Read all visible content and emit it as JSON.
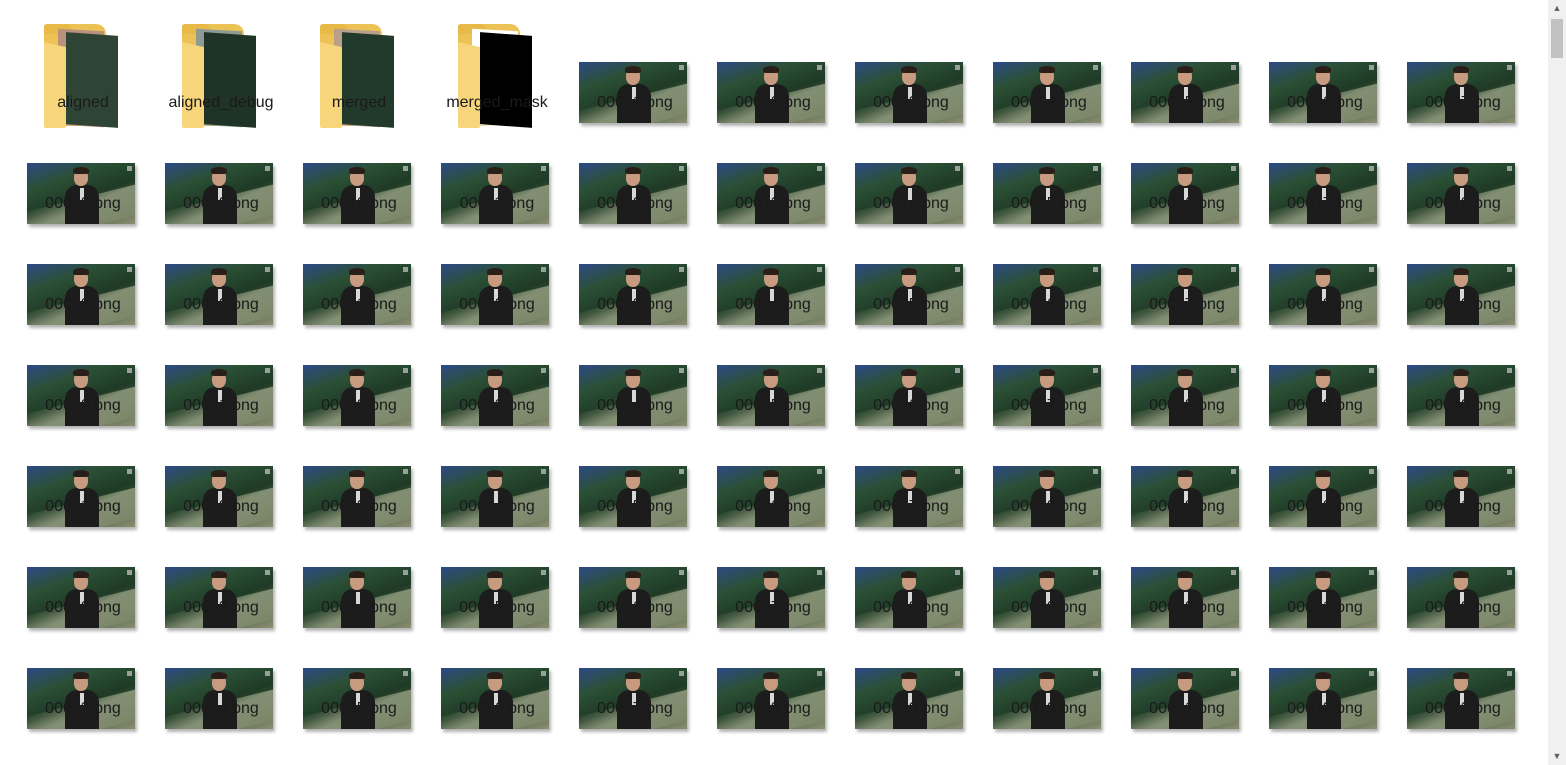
{
  "folders": [
    {
      "name": "aligned",
      "preview": "face"
    },
    {
      "name": "aligned_debug",
      "preview": "debug"
    },
    {
      "name": "merged",
      "preview": "merged"
    },
    {
      "name": "merged_mask",
      "preview": "dark"
    }
  ],
  "files": [
    "00001.png",
    "00002.png",
    "00003.png",
    "00004.png",
    "00005.png",
    "00006.png",
    "00007.png",
    "00008.png",
    "00009.png",
    "00010.png",
    "00011.png",
    "00012.png",
    "00013.png",
    "00014.png",
    "00015.png",
    "00016.png",
    "00017.png",
    "00018.png",
    "00019.png",
    "00020.png",
    "00021.png",
    "00022.png",
    "00023.png",
    "00024.png",
    "00025.png",
    "00026.png",
    "00027.png",
    "00028.png",
    "00029.png",
    "00030.png",
    "00031.png",
    "00032.png",
    "00033.png",
    "00034.png",
    "00035.png",
    "00036.png",
    "00037.png",
    "00038.png",
    "00039.png",
    "00040.png",
    "00041.png",
    "00042.png",
    "00043.png",
    "00044.png",
    "00045.png",
    "00046.png",
    "00047.png",
    "00048.png",
    "00049.png",
    "00050.png",
    "00051.png",
    "00052.png",
    "00053.png",
    "00054.png",
    "00055.png",
    "00056.png",
    "00057.png",
    "00058.png",
    "00059.png",
    "00060.png",
    "00061.png",
    "00062.png",
    "00063.png",
    "00064.png",
    "00065.png",
    "00066.png",
    "00067.png",
    "00068.png",
    "00069.png",
    "00070.png",
    "00071.png",
    "00072.png",
    "00073.png"
  ],
  "icons": {
    "scroll_up": "scroll-up-arrow-icon",
    "scroll_down": "scroll-down-arrow-icon"
  },
  "scrollbar": {
    "position_fraction": 0.0
  }
}
